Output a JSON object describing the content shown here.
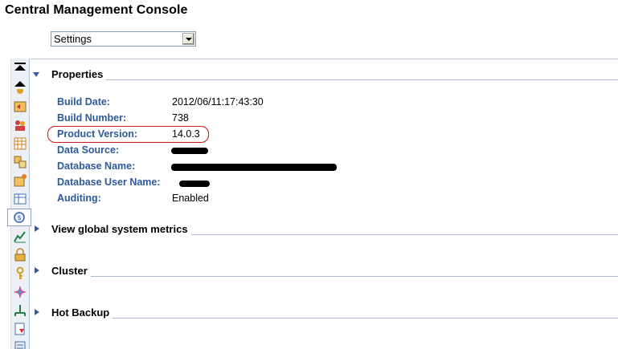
{
  "app": {
    "title": "Central Management Console"
  },
  "view_selector": {
    "selected": "Settings"
  },
  "toolbar": {
    "items": [
      {
        "icon": "scroll-top-icon"
      },
      {
        "icon": "scroll-up-icon"
      },
      {
        "icon": "users-groups-icon"
      },
      {
        "icon": "back-folder-icon"
      },
      {
        "icon": "access-levels-icon"
      },
      {
        "icon": "calendars-icon"
      },
      {
        "icon": "categories-icon"
      },
      {
        "icon": "inbox-icon"
      },
      {
        "icon": "table-icon"
      },
      {
        "icon": "settings-icon",
        "selected": true
      },
      {
        "icon": "metrics-icon"
      },
      {
        "icon": "lock-icon"
      },
      {
        "icon": "key-icon"
      },
      {
        "icon": "star-icon"
      },
      {
        "icon": "network-icon"
      },
      {
        "icon": "applications-icon"
      },
      {
        "icon": "servers-icon"
      }
    ]
  },
  "sections": {
    "properties": {
      "title": "Properties",
      "expanded": true,
      "rows": [
        {
          "label": "Build Date:",
          "value": "2012/06/11:17:43:30"
        },
        {
          "label": "Build Number:",
          "value": "738"
        },
        {
          "label": "Product Version:",
          "value": "14.0.3"
        },
        {
          "label": "Data Source:",
          "value": ""
        },
        {
          "label": "Database Name:",
          "value": ""
        },
        {
          "label": "Database User Name:",
          "value": ""
        },
        {
          "label": "Auditing:",
          "value": "Enabled"
        }
      ]
    },
    "metrics": {
      "title": "View global system metrics",
      "expanded": false
    },
    "cluster": {
      "title": "Cluster",
      "expanded": false
    },
    "backup": {
      "title": "Hot Backup",
      "expanded": false
    }
  },
  "annotations": {
    "highlight_color": "#d01818"
  },
  "colors": {
    "label_blue": "#2e5a9a",
    "accent": "#3a5ba0"
  }
}
